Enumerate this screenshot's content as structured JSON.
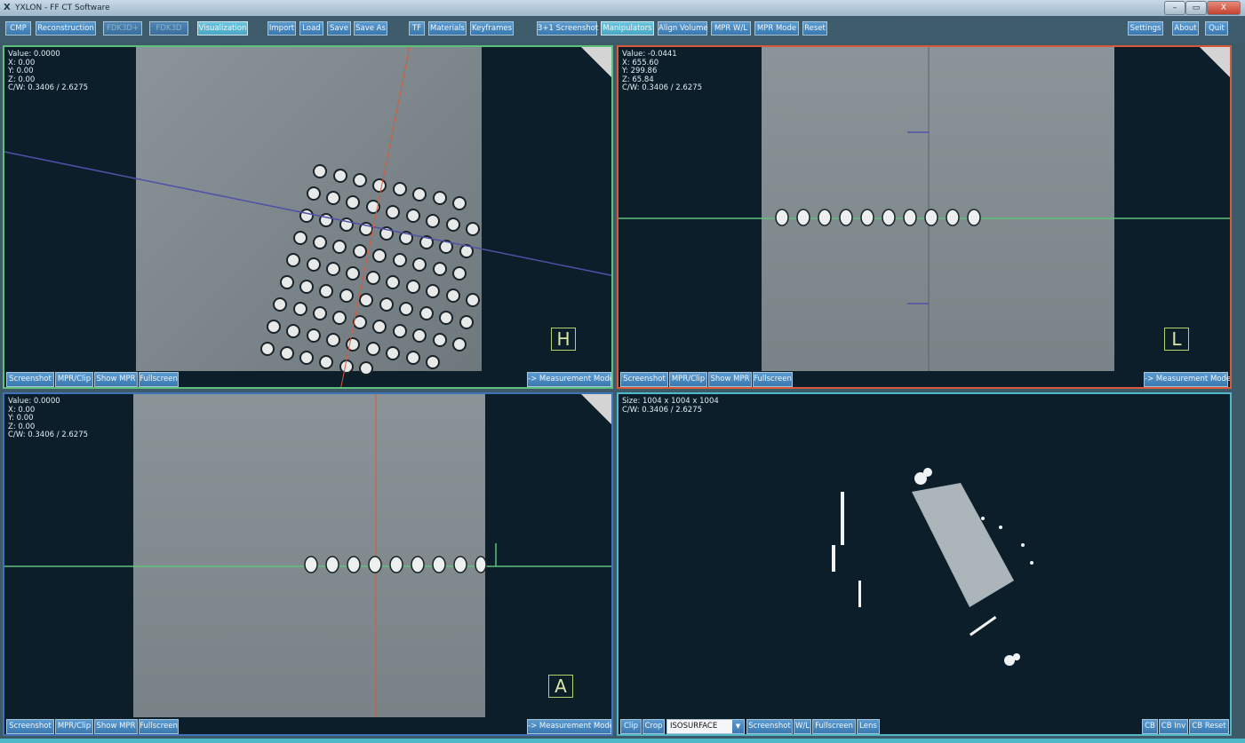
{
  "window": {
    "title": "YXLON - FF CT Software",
    "logo": "X",
    "min": "–",
    "max": "▭",
    "close": "X"
  },
  "toolbar": {
    "cmp": "CMP",
    "reconstruction": "Reconstruction",
    "disabled1": "FDK3D+",
    "disabled2": "FDK3D",
    "visualization": "Visualization",
    "import": "Import",
    "load": "Load",
    "save": "Save",
    "save_as": "Save As",
    "tf": "TF",
    "materials": "Materials",
    "keyframes": "Keyframes",
    "screenshot_3plus1": "3+1 Screenshot",
    "manipulators": "Manipulators",
    "align_volume": "Align Volume",
    "mpr_wl": "MPR W/L",
    "mpr_mode": "MPR Mode",
    "reset": "Reset",
    "settings": "Settings",
    "about": "About",
    "quit": "Quit"
  },
  "viewports": {
    "top_left": {
      "info": [
        "Value: 0.0000",
        "X: 0.00",
        "Y: 0.00",
        "Z: 0.00",
        "C/W: 0.3406 / 2.6275"
      ],
      "orientation": "H",
      "buttons": [
        "Screenshot",
        "MPR/Clip",
        "Show MPR",
        "Fullscreen"
      ],
      "measurement": "-> Measurement Mode"
    },
    "top_right": {
      "info": [
        "Value: -0.0441",
        "X: 655.60",
        "Y: 299.86",
        "Z: 65.84",
        "C/W: 0.3406 / 2.6275"
      ],
      "orientation": "L",
      "buttons": [
        "Screenshot",
        "MPR/Clip",
        "Show MPR",
        "Fullscreen"
      ],
      "measurement": "-> Measurement Mode"
    },
    "bottom_left": {
      "info": [
        "Value: 0.0000",
        "X: 0.00",
        "Y: 0.00",
        "Z: 0.00",
        "C/W: 0.3406 / 2.6275"
      ],
      "orientation": "A",
      "buttons": [
        "Screenshot",
        "MPR/Clip",
        "Show MPR",
        "Fullscreen"
      ],
      "measurement": "-> Measurement Mode"
    },
    "bottom_right": {
      "info": [
        "Size: 1004 x 1004 x 1004",
        "C/W: 0.3406 / 2.6275"
      ],
      "clip": "Clip",
      "crop": "Crop",
      "render_mode": "ISOSURFACE",
      "buttons": [
        "Screenshot",
        "W/L",
        "Fullscreen",
        "Lens"
      ],
      "right_buttons": [
        "CB",
        "CB Inv",
        "CB Reset"
      ]
    }
  },
  "colors": {
    "toolbar_button": "#4a8ac3",
    "active_button": "#5bb8d2",
    "green_line": "#5dc17b",
    "red_line": "#d85a3a",
    "blue_line": "#5050a8"
  }
}
